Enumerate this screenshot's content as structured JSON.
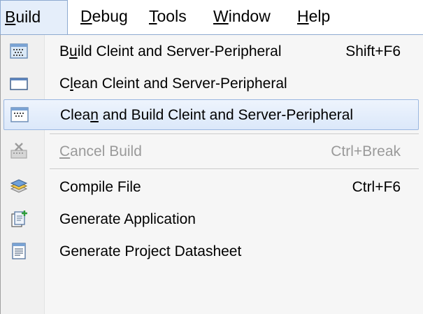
{
  "menubar": {
    "items": [
      {
        "pre": "",
        "key": "B",
        "post": "uild"
      },
      {
        "pre": "",
        "key": "D",
        "post": "ebug"
      },
      {
        "pre": "",
        "key": "T",
        "post": "ools"
      },
      {
        "pre": "",
        "key": "W",
        "post": "indow"
      },
      {
        "pre": "",
        "key": "H",
        "post": "elp"
      }
    ]
  },
  "build_menu": {
    "items": [
      {
        "pre": "B",
        "key": "u",
        "post": "ild Cleint and Server-Peripheral",
        "shortcut": "Shift+F6",
        "icon": "build-icon"
      },
      {
        "pre": "C",
        "key": "l",
        "post": "ean Cleint and Server-Peripheral",
        "shortcut": "",
        "icon": "clean-icon"
      },
      {
        "pre": "Clea",
        "key": "n",
        "post": " and Build Cleint and Server-Peripheral",
        "shortcut": "",
        "icon": "clean-build-icon",
        "highlighted": true
      },
      {
        "pre": "",
        "key": "C",
        "post": "ancel Build",
        "shortcut": "Ctrl+Break",
        "icon": "cancel-build-icon",
        "disabled": true
      },
      {
        "pre": "Compile File",
        "key": "",
        "post": "",
        "shortcut": "Ctrl+F6",
        "icon": "compile-icon"
      },
      {
        "pre": "Generate Application",
        "key": "",
        "post": "",
        "shortcut": "",
        "icon": "generate-application-icon"
      },
      {
        "pre": "Generate Project Datasheet",
        "key": "",
        "post": "",
        "shortcut": "",
        "icon": "datasheet-icon"
      }
    ]
  },
  "colors": {
    "highlight": "#dbe8fa",
    "highlight_border": "#9ab7e0",
    "disabled_text": "#9a9a9a",
    "menu_background": "#f6f6f6"
  }
}
